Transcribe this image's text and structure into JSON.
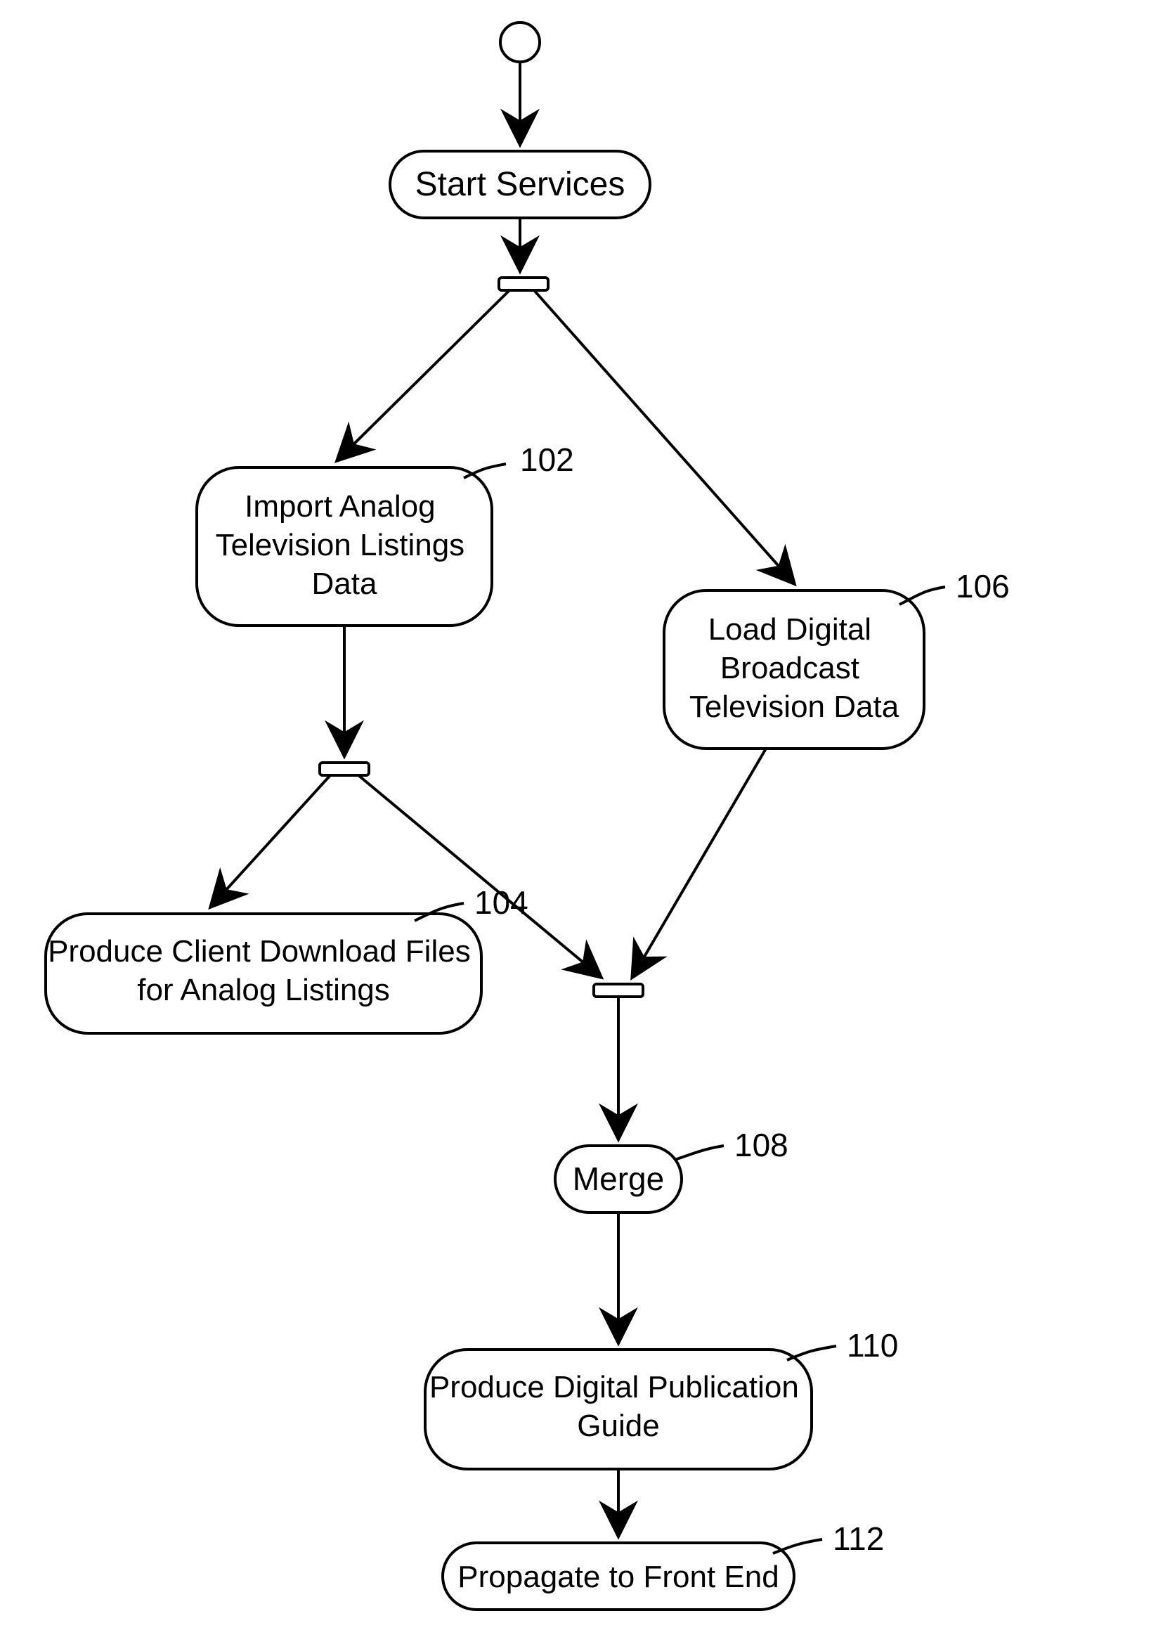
{
  "nodes": {
    "start": {
      "label": "Start Services",
      "ref": null
    },
    "n102": {
      "label": "Import Analog\nTelevision Listings\nData",
      "ref": "102"
    },
    "n104": {
      "label": "Produce Client Download Files\nfor Analog Listings",
      "ref": "104"
    },
    "n106": {
      "label": "Load Digital\nBroadcast\nTelevision Data",
      "ref": "106"
    },
    "n108": {
      "label": "Merge",
      "ref": "108"
    },
    "n110": {
      "label": "Produce Digital Publication\nGuide",
      "ref": "110"
    },
    "n112": {
      "label": "Propagate to Front End",
      "ref": "112"
    }
  },
  "chart_data": {
    "type": "activity-diagram",
    "title": null,
    "nodes": [
      {
        "id": "init",
        "kind": "initial"
      },
      {
        "id": "start",
        "kind": "action",
        "label": "Start Services"
      },
      {
        "id": "fork1",
        "kind": "fork"
      },
      {
        "id": "n102",
        "kind": "action",
        "label": "Import Analog Television Listings Data",
        "ref": "102"
      },
      {
        "id": "n106",
        "kind": "action",
        "label": "Load Digital Broadcast Television Data",
        "ref": "106"
      },
      {
        "id": "fork2",
        "kind": "fork"
      },
      {
        "id": "n104",
        "kind": "action",
        "label": "Produce Client Download Files for Analog Listings",
        "ref": "104"
      },
      {
        "id": "join1",
        "kind": "join"
      },
      {
        "id": "n108",
        "kind": "action",
        "label": "Merge",
        "ref": "108"
      },
      {
        "id": "n110",
        "kind": "action",
        "label": "Produce Digital Publication Guide",
        "ref": "110"
      },
      {
        "id": "n112",
        "kind": "action",
        "label": "Propagate to Front End",
        "ref": "112"
      }
    ],
    "edges": [
      [
        "init",
        "start"
      ],
      [
        "start",
        "fork1"
      ],
      [
        "fork1",
        "n102"
      ],
      [
        "fork1",
        "n106"
      ],
      [
        "n102",
        "fork2"
      ],
      [
        "fork2",
        "n104"
      ],
      [
        "fork2",
        "join1"
      ],
      [
        "n106",
        "join1"
      ],
      [
        "join1",
        "n108"
      ],
      [
        "n108",
        "n110"
      ],
      [
        "n110",
        "n112"
      ]
    ]
  }
}
